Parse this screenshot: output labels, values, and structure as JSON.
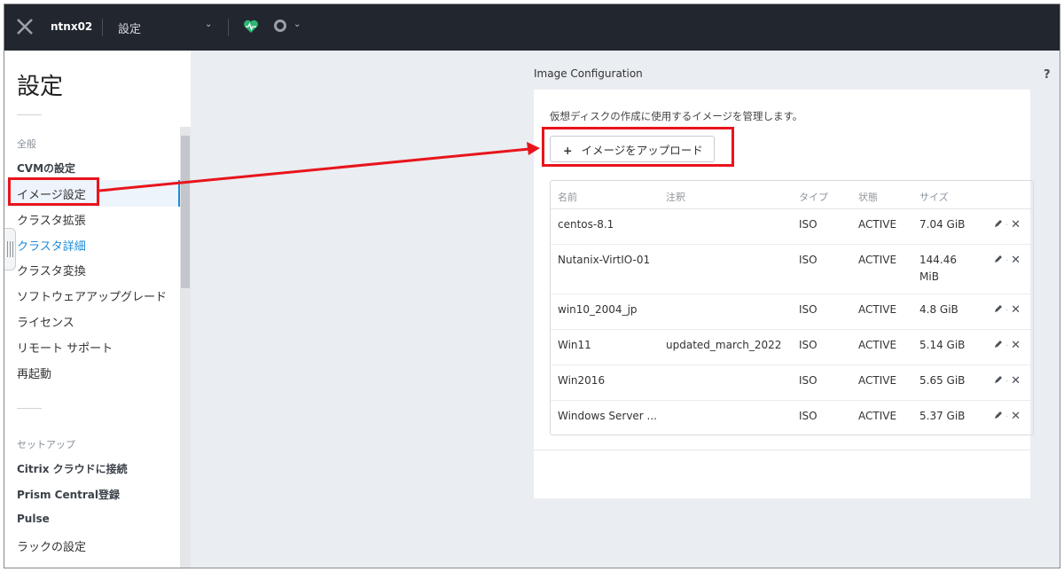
{
  "topbar": {
    "cluster_name": "ntnx02",
    "page_name": "設定"
  },
  "sidebar": {
    "title": "設定",
    "groups": [
      {
        "label": "全般",
        "items": [
          {
            "label": "CVMの設定"
          },
          {
            "label": "イメージ設定"
          },
          {
            "label": "クラスタ拡張"
          },
          {
            "label": "クラスタ詳細"
          },
          {
            "label": "クラスタ変換"
          },
          {
            "label": "ソフトウェアアップグレード"
          },
          {
            "label": "ライセンス"
          },
          {
            "label": "リモート サポート"
          },
          {
            "label": "再起動"
          }
        ]
      },
      {
        "label": "セットアップ",
        "items": [
          {
            "label": "Citrix クラウドに接続"
          },
          {
            "label": "Prism Central登録"
          },
          {
            "label": "Pulse"
          },
          {
            "label": "ラックの設定"
          }
        ]
      }
    ]
  },
  "main": {
    "section_title": "Image Configuration",
    "help_label": "?",
    "description": "仮想ディスクの作成に使用するイメージを管理します。",
    "upload_label": "イメージをアップロード",
    "upload_icon": "+",
    "columns": [
      "名前",
      "注釈",
      "タイプ",
      "状態",
      "サイズ"
    ],
    "rows": [
      {
        "name": "centos-8.1",
        "note": "",
        "type": "ISO",
        "state": "ACTIVE",
        "size": "7.04 GiB"
      },
      {
        "name": "Nutanix-VirtIO-01",
        "note": "",
        "type": "ISO",
        "state": "ACTIVE",
        "size": "144.46 MiB"
      },
      {
        "name": "win10_2004_jp",
        "note": "",
        "type": "ISO",
        "state": "ACTIVE",
        "size": "4.8 GiB"
      },
      {
        "name": "Win11",
        "note": "updated_march_2022",
        "type": "ISO",
        "state": "ACTIVE",
        "size": "5.14 GiB"
      },
      {
        "name": "Win2016",
        "note": "",
        "type": "ISO",
        "state": "ACTIVE",
        "size": "5.65 GiB"
      },
      {
        "name": "Windows Server ...",
        "note": "",
        "type": "ISO",
        "state": "ACTIVE",
        "size": "5.37 GiB"
      }
    ],
    "row_actions": {
      "edit_icon": "pencil-icon",
      "separator": "·",
      "delete_icon": "✕"
    }
  },
  "colors": {
    "highlight": "#e8141c",
    "topbar": "#22262e",
    "accent": "#1f8bd6",
    "health": "#2bb673"
  }
}
